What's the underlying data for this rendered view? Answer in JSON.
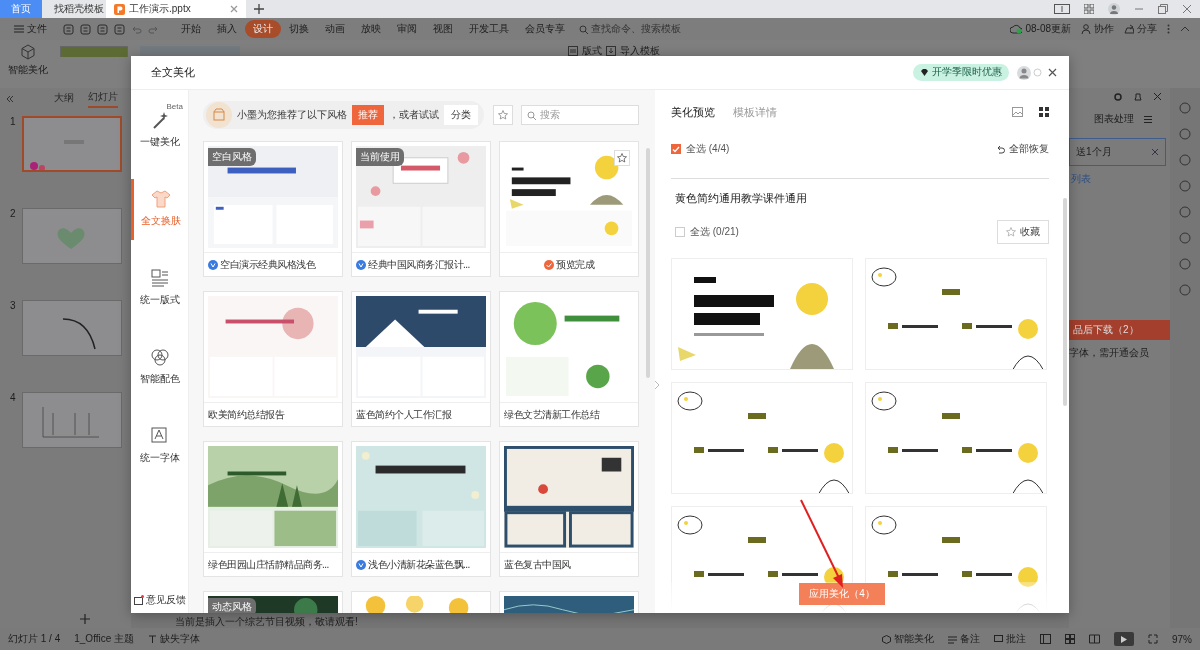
{
  "browser_tabs": [
    {
      "label": "首页",
      "kind": "home",
      "selected": false
    },
    {
      "label": "找稻壳模板",
      "kind": "web",
      "selected": false
    },
    {
      "label": "工作演示.pptx",
      "kind": "doc",
      "selected": true
    }
  ],
  "menu": {
    "file": "文件",
    "items": [
      {
        "label": "开始",
        "selected": false
      },
      {
        "label": "插入",
        "selected": false
      },
      {
        "label": "设计",
        "selected": true
      },
      {
        "label": "切换",
        "selected": false
      },
      {
        "label": "动画",
        "selected": false
      },
      {
        "label": "放映",
        "selected": false
      },
      {
        "label": "审阅",
        "selected": false
      },
      {
        "label": "视图",
        "selected": false
      },
      {
        "label": "开发工具",
        "selected": false
      },
      {
        "label": "会员专享",
        "selected": false
      }
    ],
    "search_placeholder": "查找命令、搜索模板",
    "update": "08-08更新",
    "collaborate": "协作",
    "share": "分享"
  },
  "toolbar": {
    "smart_beautify": "智能美化",
    "layout": "版式",
    "import_template": "导入模板"
  },
  "slide_pane": {
    "tabs": [
      {
        "label": "大纲",
        "selected": false
      },
      {
        "label": "幻灯片",
        "selected": true
      }
    ],
    "slides": [
      {
        "number": "1",
        "kind": "title",
        "selected": true
      },
      {
        "number": "2",
        "kind": "heart",
        "selected": false
      },
      {
        "number": "3",
        "kind": "arc",
        "selected": false
      },
      {
        "number": "4",
        "kind": "chart",
        "selected": false
      }
    ]
  },
  "side_panel": {
    "tab": "图表处理",
    "field_value": "送1个月",
    "link": "列表",
    "download": "品后下载（2）",
    "note": "字体，需开通会员"
  },
  "notes": "当前是插入一个综艺节目视频，敬请观看!",
  "status_bar": {
    "slide": "幻灯片 1 / 4",
    "theme": "1_Office 主题",
    "missing_font": "缺失字体",
    "smart": "智能美化",
    "notes": "备注",
    "comments": "批注",
    "zoom": "97%"
  },
  "dialog": {
    "title": "全文美化",
    "promo": "开学季限时优惠",
    "nav": [
      {
        "label": "一键美化",
        "kind": "wand",
        "badge": "Beta",
        "selected": false
      },
      {
        "label": "全文换肤",
        "kind": "shirt",
        "selected": true
      },
      {
        "label": "统一版式",
        "kind": "layout",
        "selected": false
      },
      {
        "label": "智能配色",
        "kind": "color",
        "selected": false
      },
      {
        "label": "统一字体",
        "kind": "font",
        "selected": false
      }
    ],
    "feedback": "意见反馈",
    "recommend": {
      "text": "小墨为您推荐了以下风格",
      "button": "推荐",
      "or": "，或者试试",
      "category": "分类"
    },
    "search_placeholder": "搜索",
    "cards": [
      {
        "preview": {
          "kind": "blank"
        },
        "tag": "空白风格",
        "caption": "空白演示经典风格浅色",
        "kind": "vip",
        "favorite": false
      },
      {
        "preview": {
          "kind": "ink"
        },
        "tag": "当前使用",
        "caption": "经典中国风商务汇报计...",
        "kind": "vip",
        "favorite": false
      },
      {
        "preview": {
          "kind": "cartoon"
        },
        "caption": "预览完成",
        "kind": "done",
        "favorite": true
      },
      {
        "preview": {
          "kind": "pink"
        },
        "caption": "欧美简约总结报告",
        "kind": "plain",
        "favorite": false
      },
      {
        "preview": {
          "kind": "navy"
        },
        "caption": "蓝色简约个人工作汇报",
        "kind": "plain",
        "favorite": false
      },
      {
        "preview": {
          "kind": "green"
        },
        "caption": "绿色文艺清新工作总结",
        "kind": "plain",
        "favorite": false
      },
      {
        "preview": {
          "kind": "landscape"
        },
        "caption": "绿色田园山庄恬静精品商务...",
        "kind": "plain",
        "favorite": false
      },
      {
        "preview": {
          "kind": "floral"
        },
        "caption": "浅色小清新花朵蓝色飘...",
        "kind": "vip",
        "favorite": false
      },
      {
        "preview": {
          "kind": "retro"
        },
        "caption": "蓝色复古中国风",
        "kind": "plain",
        "favorite": false
      },
      {
        "preview": {
          "kind": "dark"
        },
        "tag": "动态风格",
        "favorite": false
      },
      {
        "preview": {
          "kind": "yellow"
        },
        "favorite": false
      },
      {
        "preview": {
          "kind": "ocean"
        },
        "favorite": false
      }
    ],
    "preview": {
      "tabs": [
        {
          "label": "美化预览",
          "selected": true
        },
        {
          "label": "模板详情",
          "selected": false
        }
      ],
      "select_all": {
        "label": "全选 (4/4)",
        "checked": true
      },
      "restore": "全部恢复",
      "template_title": "黄色简约通用教学课件通用",
      "template_select": {
        "label": "全选 (0/21)",
        "checked": false
      },
      "collect": "收藏",
      "slides": [
        {
          "kind": "cover"
        },
        {
          "kind": "contents"
        },
        {
          "kind": "contents"
        },
        {
          "kind": "contents"
        },
        {
          "kind": "contents"
        },
        {
          "kind": "contents"
        }
      ],
      "apply": "应用美化（4）"
    }
  }
}
